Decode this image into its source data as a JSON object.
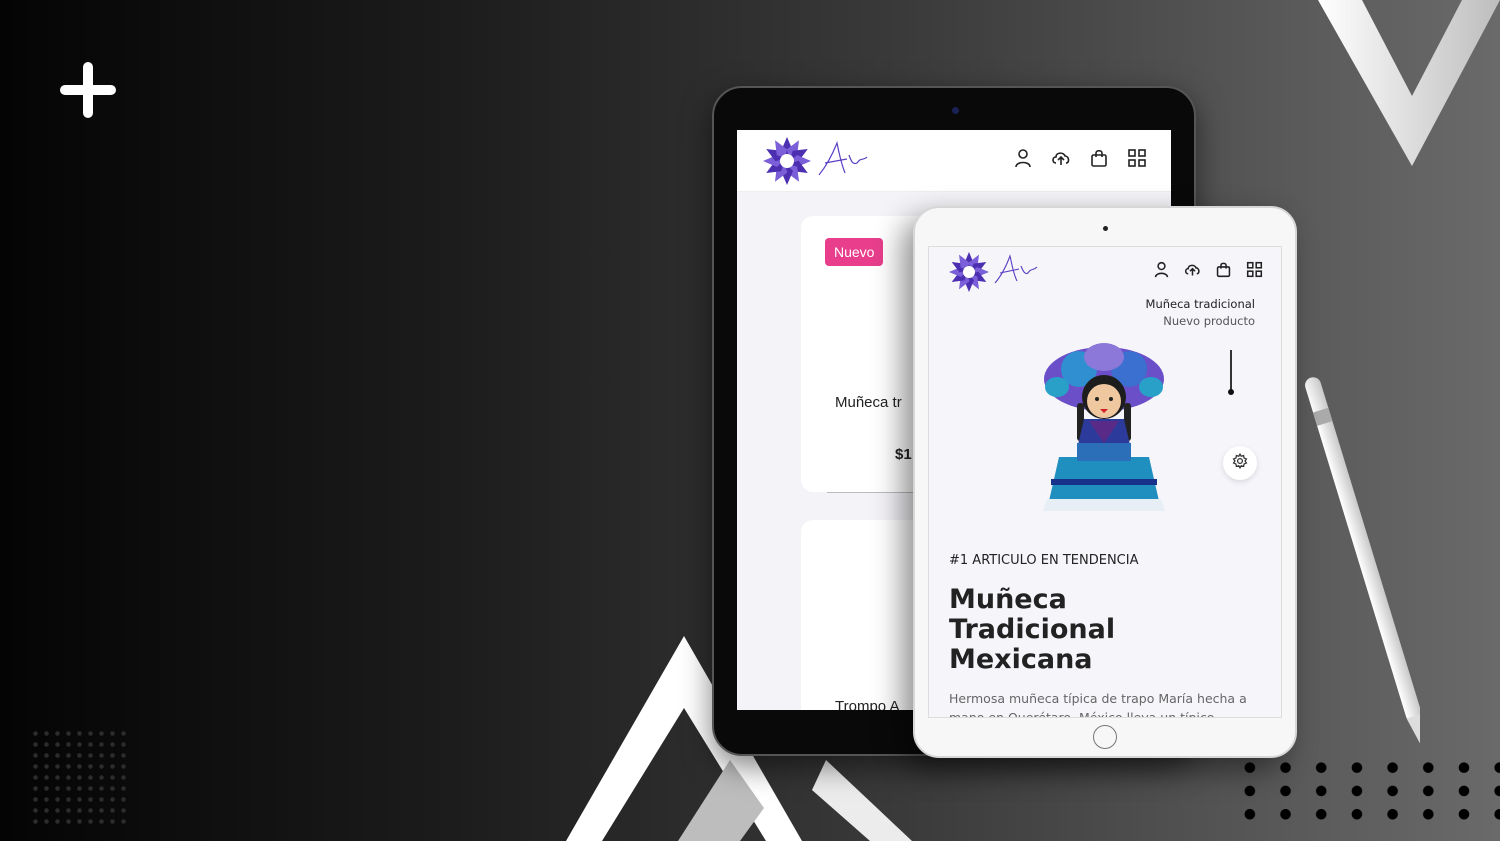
{
  "colors": {
    "accent": "#e83e8c",
    "brand": "#5b3fc4",
    "background": "#1c1c1c"
  },
  "decor_icons": [
    "plus-icon"
  ],
  "header_icons": [
    "user-icon",
    "cloud-upload-icon",
    "shopping-bag-icon",
    "grid-icon"
  ],
  "back_tablet": {
    "cards": [
      {
        "badge": "Nuevo",
        "name": "Muñeca tr",
        "price": "$1"
      },
      {
        "name": "Trompo A"
      }
    ]
  },
  "front_tablet": {
    "product_name": "Muñeca tradicional",
    "product_tag": "Nuevo producto",
    "trend_label": "#1 ARTICULO EN TENDENCIA",
    "title": "Muñeca Tradicional Mexicana",
    "description": "Hermosa muñeca típica de trapo María hecha a mano en Querétaro, México lleva un típico"
  }
}
